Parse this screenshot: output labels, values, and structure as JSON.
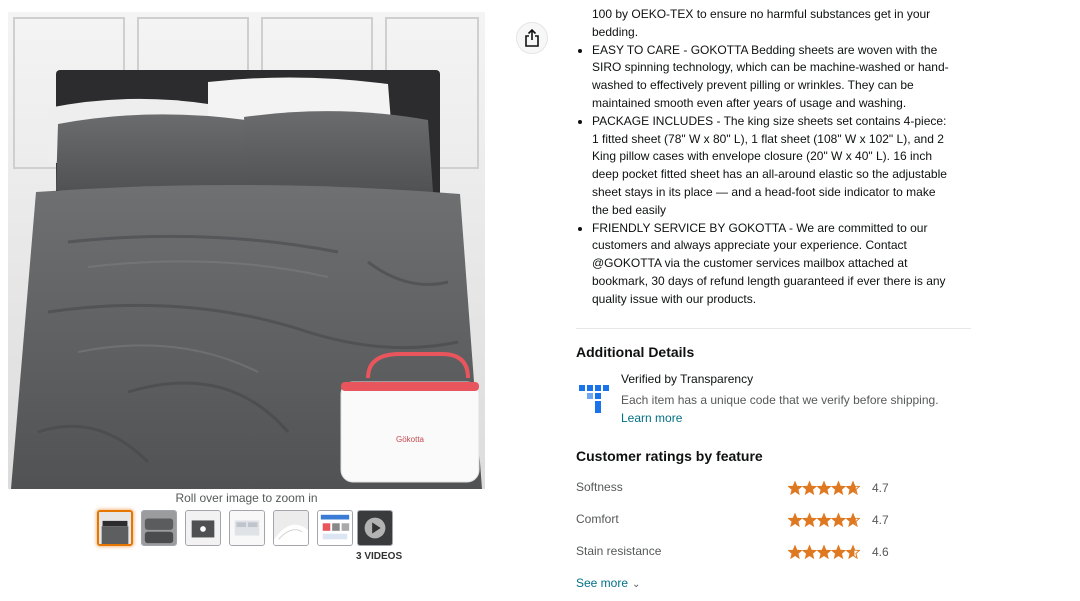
{
  "gallery": {
    "zoom_hint": "Roll over image to zoom in",
    "videos_label": "3 VIDEOS",
    "bag_brand": "Gökotta",
    "thumbnails": [
      "bed-gray",
      "pillowcases",
      "fitted-sheet-diagram",
      "bed-white",
      "sheet-fabric",
      "package-contents",
      "video"
    ]
  },
  "description": {
    "first_line": "100 by OEKO-TEX to ensure no harmful substances get in your",
    "first_line_cont": "bedding.",
    "bullets": [
      {
        "lines": [
          "EASY TO CARE - GOKOTTA Bedding sheets are woven with the",
          "SIRO spinning technology, which can be machine-washed or hand-",
          "washed to effectively prevent pilling or wrinkles. They can be",
          "maintained smooth even after years of usage and washing."
        ]
      },
      {
        "lines": [
          "PACKAGE INCLUDES - The king size sheets set contains 4-piece:",
          "1 fitted sheet (78\" W x 80\" L), 1 flat sheet (108\" W x 102\" L), and 2",
          "King pillow cases with envelope closure (20\" W x 40\" L). 16 inch",
          "deep pocket fitted sheet has an all-around elastic so the adjustable",
          "sheet stays in its place — and a head-foot side indicator to make",
          "the bed easily"
        ]
      },
      {
        "lines": [
          "FRIENDLY SERVICE BY GOKOTTA - We are committed to our",
          "customers and always appreciate your experience. Contact",
          "@GOKOTTA via the customer services mailbox attached at",
          "bookmark, 30 days of refund length guaranteed if ever there is any",
          "quality issue with our products."
        ]
      }
    ]
  },
  "additional_details": {
    "title": "Additional Details",
    "transparency_title": "Verified by Transparency",
    "transparency_desc": "Each item has a unique code that we verify before shipping.",
    "learn_more": "Learn more"
  },
  "ratings": {
    "title": "Customer ratings by feature",
    "items": [
      {
        "name": "Softness",
        "value": "4.7",
        "stars": 4.7
      },
      {
        "name": "Comfort",
        "value": "4.7",
        "stars": 4.7
      },
      {
        "name": "Stain resistance",
        "value": "4.6",
        "stars": 4.6
      }
    ],
    "see_more": "See more"
  },
  "colors": {
    "link": "#007185",
    "star": "#de7921",
    "thumb_selected": "#e77600"
  }
}
